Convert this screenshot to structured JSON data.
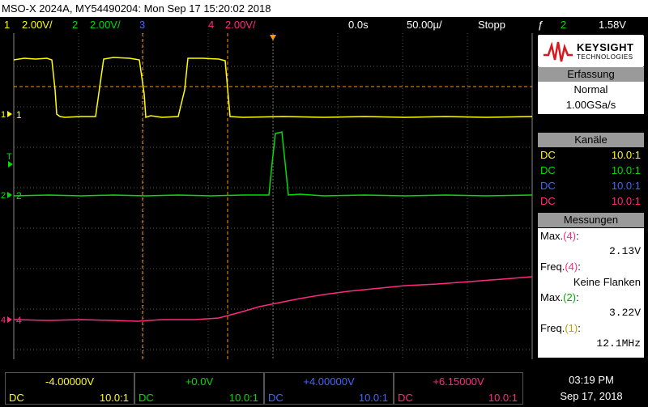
{
  "title_bar": "MSO-X 2024A, MY54490204: Mon Sep 17 15:20:02 2018",
  "status": {
    "ch1_num": "1",
    "ch1_scale": "2.00V/",
    "ch2_num": "2",
    "ch2_scale": "2.00V/",
    "ch3_num": "3",
    "ch4_num": "4",
    "ch4_scale": "2.00V/",
    "time_offset": "0.0s",
    "time_scale": "50.00µ/",
    "run_state": "Stopp",
    "trigger_symbol": "ƒ",
    "trigger_source": "2",
    "trigger_level": "1.58V"
  },
  "logo": {
    "line1": "KEYSIGHT",
    "line2": "TECHNOLOGIES"
  },
  "acquisition": {
    "heading": "Erfassung",
    "mode": "Normal",
    "rate": "1.00GSa/s"
  },
  "channels": {
    "heading": "Kanäle",
    "rows": [
      {
        "coupling": "DC",
        "probe": "10.0:1"
      },
      {
        "coupling": "DC",
        "probe": "10.0:1"
      },
      {
        "coupling": "DC",
        "probe": "10.0:1"
      },
      {
        "coupling": "DC",
        "probe": "10.0:1"
      }
    ]
  },
  "measurements": {
    "heading": "Messungen",
    "items": [
      {
        "label": "Max.",
        "src": "(4)",
        "suffix": ":",
        "value": "2.13V"
      },
      {
        "label": "Freq.",
        "src": "(4)",
        "suffix": ":",
        "value": "Keine Flanken"
      },
      {
        "label": "Max.",
        "src": "(2)",
        "suffix": ":",
        "value": "3.22V"
      },
      {
        "label": "Freq.",
        "src": "(1)",
        "suffix": ":",
        "value": "12.1MHz"
      }
    ]
  },
  "channel_markers": {
    "ch1": "1",
    "ch2": "2",
    "ch4": "4",
    "trigger": "T"
  },
  "bottom_channels": [
    {
      "offset": "-4.00000V",
      "coupling": "DC",
      "probe": "10.0:1"
    },
    {
      "offset": "+0.0V",
      "coupling": "DC",
      "probe": "10.0:1"
    },
    {
      "offset": "+4.00000V",
      "coupling": "DC",
      "probe": "10.0:1"
    },
    {
      "offset": "+6.15000V",
      "coupling": "DC",
      "probe": "10.0:1"
    }
  ],
  "clock": {
    "time": "03:19 PM",
    "date": "Sep 17, 2018"
  },
  "colors": {
    "ch1": "#ffff00",
    "ch2": "#00dd00",
    "ch3": "#4466ff",
    "ch4": "#ff2a80",
    "cursor": "#ff9900"
  }
}
